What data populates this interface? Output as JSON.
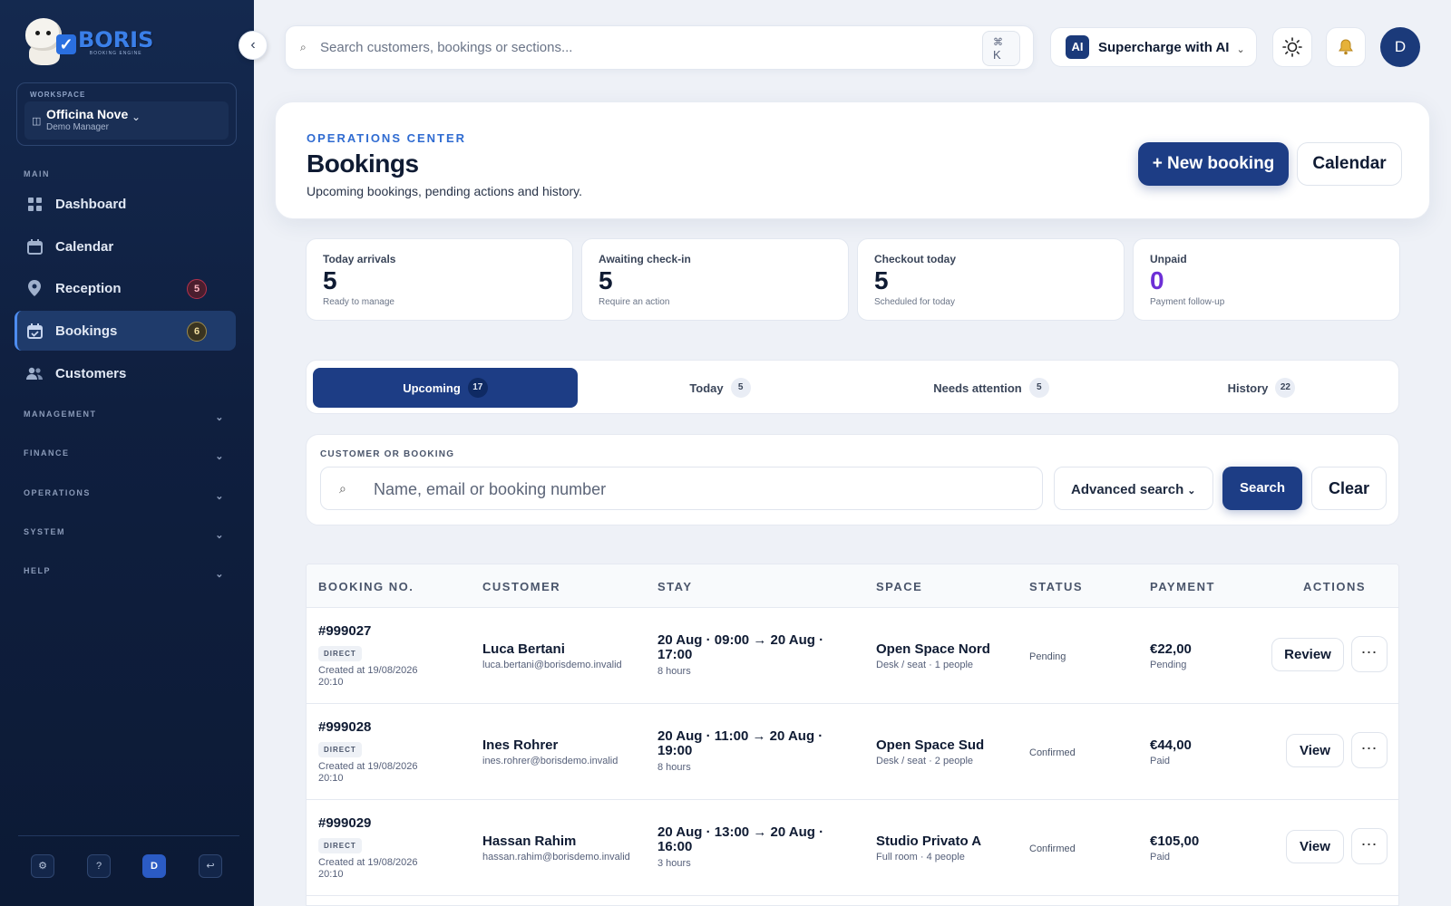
{
  "brand": {
    "name": "BORIS",
    "tagline": "BOOKING ENGINE"
  },
  "workspace": {
    "label": "WORKSPACE",
    "name": "Officina Nove",
    "role": "Demo Manager"
  },
  "sidebar": {
    "main_label": "MAIN",
    "items": [
      {
        "label": "Dashboard",
        "icon": "grid-icon"
      },
      {
        "label": "Calendar",
        "icon": "calendar-icon"
      },
      {
        "label": "Reception",
        "icon": "pin-icon",
        "badge": "5"
      },
      {
        "label": "Bookings",
        "icon": "calendar-check-icon",
        "badge": "6",
        "active": true
      },
      {
        "label": "Customers",
        "icon": "users-icon"
      }
    ],
    "groups": [
      "MANAGEMENT",
      "FINANCE",
      "OPERATIONS",
      "SYSTEM",
      "HELP"
    ],
    "bottom": {
      "settings": "⚙",
      "help": "?",
      "user": "D",
      "logout": "↩"
    }
  },
  "topbar": {
    "search_placeholder": "Search customers, bookings or sections...",
    "kbd_mod": "⌘",
    "kbd_key": "K",
    "ai_badge": "AI",
    "ai_label": "Supercharge with AI",
    "theme_icon": "☀",
    "bell_icon": "🔔",
    "avatar": "D"
  },
  "header": {
    "eyebrow": "OPERATIONS CENTER",
    "title": "Bookings",
    "subtitle": "Upcoming bookings, pending actions and history.",
    "new_booking": "+ New booking",
    "calendar": "Calendar"
  },
  "stats": [
    {
      "label": "Today arrivals",
      "value": "5",
      "hint": "Ready to manage"
    },
    {
      "label": "Awaiting check-in",
      "value": "5",
      "hint": "Require an action"
    },
    {
      "label": "Checkout today",
      "value": "5",
      "hint": "Scheduled for today"
    },
    {
      "label": "Unpaid",
      "value": "0",
      "hint": "Payment follow-up"
    }
  ],
  "tabs": [
    {
      "label": "Upcoming",
      "count": "17",
      "active": true
    },
    {
      "label": "Today",
      "count": "5"
    },
    {
      "label": "Needs attention",
      "count": "5"
    },
    {
      "label": "History",
      "count": "22"
    }
  ],
  "filter": {
    "label": "CUSTOMER OR BOOKING",
    "placeholder": "Name, email or booking number",
    "advanced": "Advanced search",
    "search": "Search",
    "clear": "Clear"
  },
  "table": {
    "headers": [
      "BOOKING NO.",
      "CUSTOMER",
      "STAY",
      "SPACE",
      "STATUS",
      "PAYMENT",
      "ACTIONS"
    ],
    "rows": [
      {
        "number": "#999027",
        "channel": "DIRECT",
        "created": "Created at 19/08/2026 20:10",
        "customer": "Luca Bertani",
        "email": "luca.bertani@borisdemo.invalid",
        "stay": "20 Aug · 09:00 → 20 Aug · 17:00",
        "duration": "8 hours",
        "space": "Open Space Nord",
        "space_detail": "Desk / seat · 1 people",
        "status": "Pending",
        "amount": "€22,00",
        "payment_status": "Pending",
        "action": "Review",
        "more": "⋯"
      },
      {
        "number": "#999028",
        "channel": "DIRECT",
        "created": "Created at 19/08/2026 20:10",
        "customer": "Ines Rohrer",
        "email": "ines.rohrer@borisdemo.invalid",
        "stay": "20 Aug · 11:00 → 20 Aug · 19:00",
        "duration": "8 hours",
        "space": "Open Space Sud",
        "space_detail": "Desk / seat · 2 people",
        "status": "Confirmed",
        "amount": "€44,00",
        "payment_status": "Paid",
        "action": "View",
        "more": "⋯"
      },
      {
        "number": "#999029",
        "channel": "DIRECT",
        "created": "Created at 19/08/2026 20:10",
        "customer": "Hassan Rahim",
        "email": "hassan.rahim@borisdemo.invalid",
        "stay": "20 Aug · 13:00 → 20 Aug · 16:00",
        "duration": "3 hours",
        "space": "Studio Privato A",
        "space_detail": "Full room · 4 people",
        "status": "Confirmed",
        "amount": "€105,00",
        "payment_status": "Paid",
        "action": "View",
        "more": "⋯"
      }
    ]
  },
  "colors": {
    "primary": "#1d3d85",
    "sidebar": "#0f1f3f",
    "accent": "#2f6bd1",
    "unpaid": "#6d2fd6"
  }
}
